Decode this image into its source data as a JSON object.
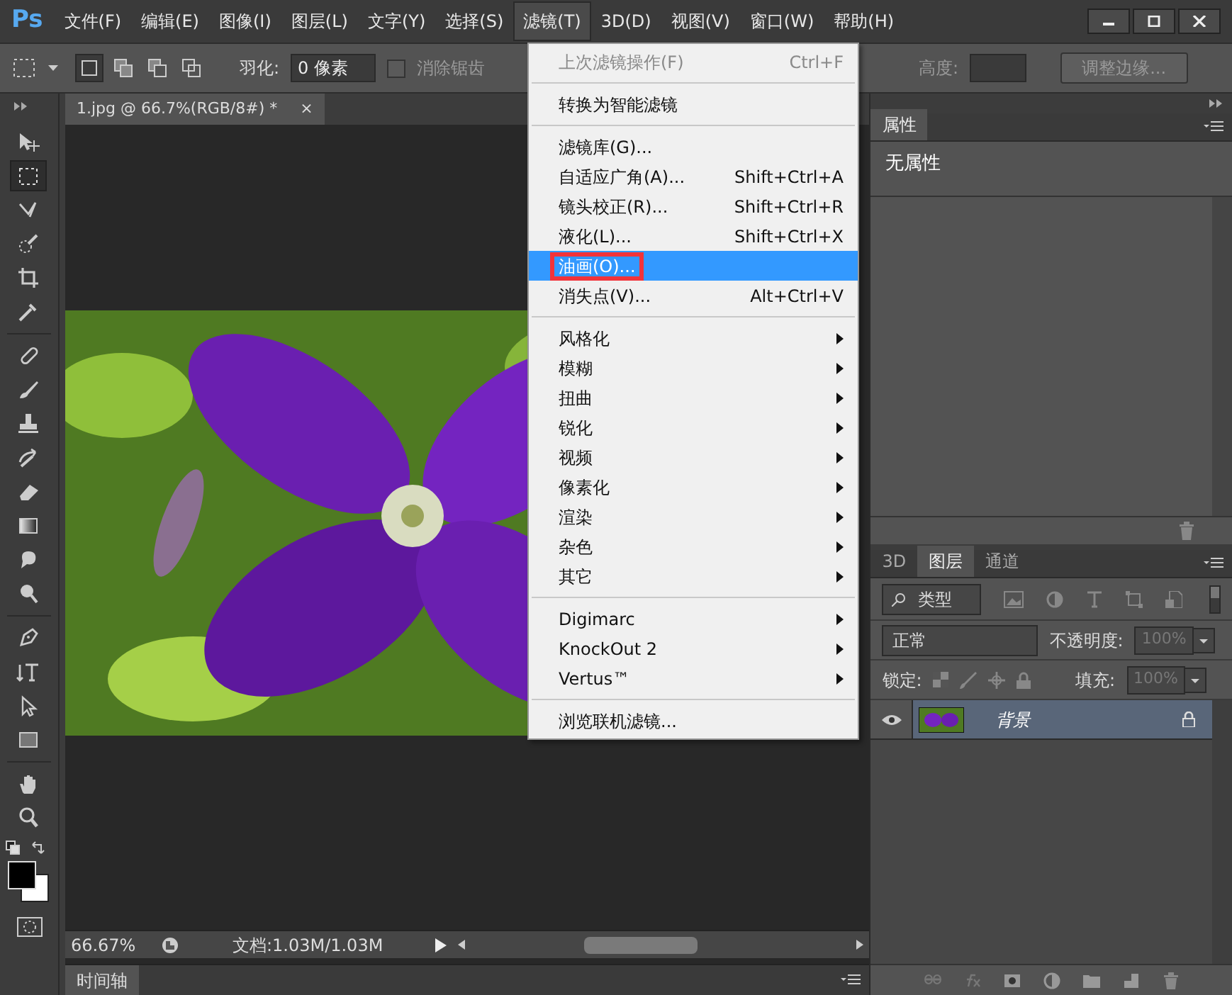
{
  "app_logo": "Ps",
  "menubar": [
    {
      "label": "文件(F)",
      "selected": false
    },
    {
      "label": "编辑(E)",
      "selected": false
    },
    {
      "label": "图像(I)",
      "selected": false
    },
    {
      "label": "图层(L)",
      "selected": false
    },
    {
      "label": "文字(Y)",
      "selected": false
    },
    {
      "label": "选择(S)",
      "selected": false
    },
    {
      "label": "滤镜(T)",
      "selected": true
    },
    {
      "label": "3D(D)",
      "selected": false
    },
    {
      "label": "视图(V)",
      "selected": false
    },
    {
      "label": "窗口(W)",
      "selected": false
    },
    {
      "label": "帮助(H)",
      "selected": false
    }
  ],
  "options_bar": {
    "modes": [
      {
        "selected": true
      },
      {
        "selected": false
      },
      {
        "selected": false
      },
      {
        "selected": false
      }
    ],
    "feather_label": "羽化:",
    "feather_value": "0 像素",
    "antialias": {
      "label": "消除锯齿",
      "checked": false,
      "disabled": true
    },
    "height_label": "高度:",
    "refine_button": "调整边缘..."
  },
  "tools": [
    {
      "kind": "move",
      "selected": false
    },
    {
      "kind": "marquee",
      "selected": true
    },
    {
      "kind": "lasso",
      "selected": false
    },
    {
      "kind": "quick-select",
      "selected": false
    },
    {
      "kind": "crop",
      "selected": false
    },
    {
      "kind": "eyedropper",
      "selected": false
    },
    {
      "kind": "separator"
    },
    {
      "kind": "heal",
      "selected": false
    },
    {
      "kind": "brush",
      "selected": false
    },
    {
      "kind": "stamp",
      "selected": false
    },
    {
      "kind": "history",
      "selected": false
    },
    {
      "kind": "eraser",
      "selected": false
    },
    {
      "kind": "gradient",
      "selected": false
    },
    {
      "kind": "blur",
      "selected": false
    },
    {
      "kind": "dodge",
      "selected": false
    },
    {
      "kind": "separator"
    },
    {
      "kind": "pen",
      "selected": false
    },
    {
      "kind": "type",
      "selected": false
    },
    {
      "kind": "path-select",
      "selected": false
    },
    {
      "kind": "shape",
      "selected": false
    },
    {
      "kind": "separator"
    },
    {
      "kind": "hand",
      "selected": false
    },
    {
      "kind": "zoom",
      "selected": false
    }
  ],
  "document": {
    "tab_title": "1.jpg @ 66.7%(RGB/8#) *",
    "tab_close": "×",
    "zoom": "66.67%",
    "doc_info": "文档:1.03M/1.03M"
  },
  "timeline": {
    "tab": "时间轴"
  },
  "filter_menu": {
    "items": [
      {
        "kind": "item",
        "label": "上次滤镜操作(F)",
        "shortcut": "Ctrl+F",
        "disabled": true,
        "selected": false,
        "annotated": false
      },
      {
        "kind": "separator"
      },
      {
        "kind": "item",
        "label": "转换为智能滤镜",
        "disabled": false,
        "selected": false,
        "annotated": false
      },
      {
        "kind": "separator"
      },
      {
        "kind": "item",
        "label": "滤镜库(G)...",
        "disabled": false,
        "selected": false,
        "annotated": false
      },
      {
        "kind": "item",
        "label": "自适应广角(A)...",
        "shortcut": "Shift+Ctrl+A",
        "disabled": false,
        "selected": false,
        "annotated": false
      },
      {
        "kind": "item",
        "label": "镜头校正(R)...",
        "shortcut": "Shift+Ctrl+R",
        "disabled": false,
        "selected": false,
        "annotated": false
      },
      {
        "kind": "item",
        "label": "液化(L)...",
        "shortcut": "Shift+Ctrl+X",
        "disabled": false,
        "selected": false,
        "annotated": false
      },
      {
        "kind": "item",
        "label": "油画(O)...",
        "disabled": false,
        "selected": true,
        "annotated": true
      },
      {
        "kind": "item",
        "label": "消失点(V)...",
        "shortcut": "Alt+Ctrl+V",
        "disabled": false,
        "selected": false,
        "annotated": false
      },
      {
        "kind": "separator"
      },
      {
        "kind": "submenu",
        "label": "风格化",
        "disabled": false,
        "selected": false,
        "annotated": false
      },
      {
        "kind": "submenu",
        "label": "模糊",
        "disabled": false,
        "selected": false,
        "annotated": false
      },
      {
        "kind": "submenu",
        "label": "扭曲",
        "disabled": false,
        "selected": false,
        "annotated": false
      },
      {
        "kind": "submenu",
        "label": "锐化",
        "disabled": false,
        "selected": false,
        "annotated": false
      },
      {
        "kind": "submenu",
        "label": "视频",
        "disabled": false,
        "selected": false,
        "annotated": false
      },
      {
        "kind": "submenu",
        "label": "像素化",
        "disabled": false,
        "selected": false,
        "annotated": false
      },
      {
        "kind": "submenu",
        "label": "渲染",
        "disabled": false,
        "selected": false,
        "annotated": false
      },
      {
        "kind": "submenu",
        "label": "杂色",
        "disabled": false,
        "selected": false,
        "annotated": false
      },
      {
        "kind": "submenu",
        "label": "其它",
        "disabled": false,
        "selected": false,
        "annotated": false
      },
      {
        "kind": "separator"
      },
      {
        "kind": "submenu",
        "label": "Digimarc",
        "disabled": false,
        "selected": false,
        "annotated": false
      },
      {
        "kind": "submenu",
        "label": "KnockOut 2",
        "disabled": false,
        "selected": false,
        "annotated": false
      },
      {
        "kind": "submenu",
        "label": "Vertus™",
        "disabled": false,
        "selected": false,
        "annotated": false
      },
      {
        "kind": "separator"
      },
      {
        "kind": "item",
        "label": "浏览联机滤镜...",
        "disabled": false,
        "selected": false,
        "annotated": false
      }
    ]
  },
  "properties_panel": {
    "tab": "属性",
    "content": "无属性"
  },
  "layers_panel": {
    "tabs": [
      {
        "label": "3D",
        "selected": false
      },
      {
        "label": "图层",
        "selected": true
      },
      {
        "label": "通道",
        "selected": false
      }
    ],
    "filter_kind": "类型",
    "blend_mode": "正常",
    "opacity_label": "不透明度:",
    "opacity": "100%",
    "lock_label": "锁定:",
    "fill_label": "填充:",
    "fill": "100%",
    "layers": [
      {
        "name": "背景",
        "visible": true,
        "locked": true,
        "selected": true
      }
    ]
  }
}
